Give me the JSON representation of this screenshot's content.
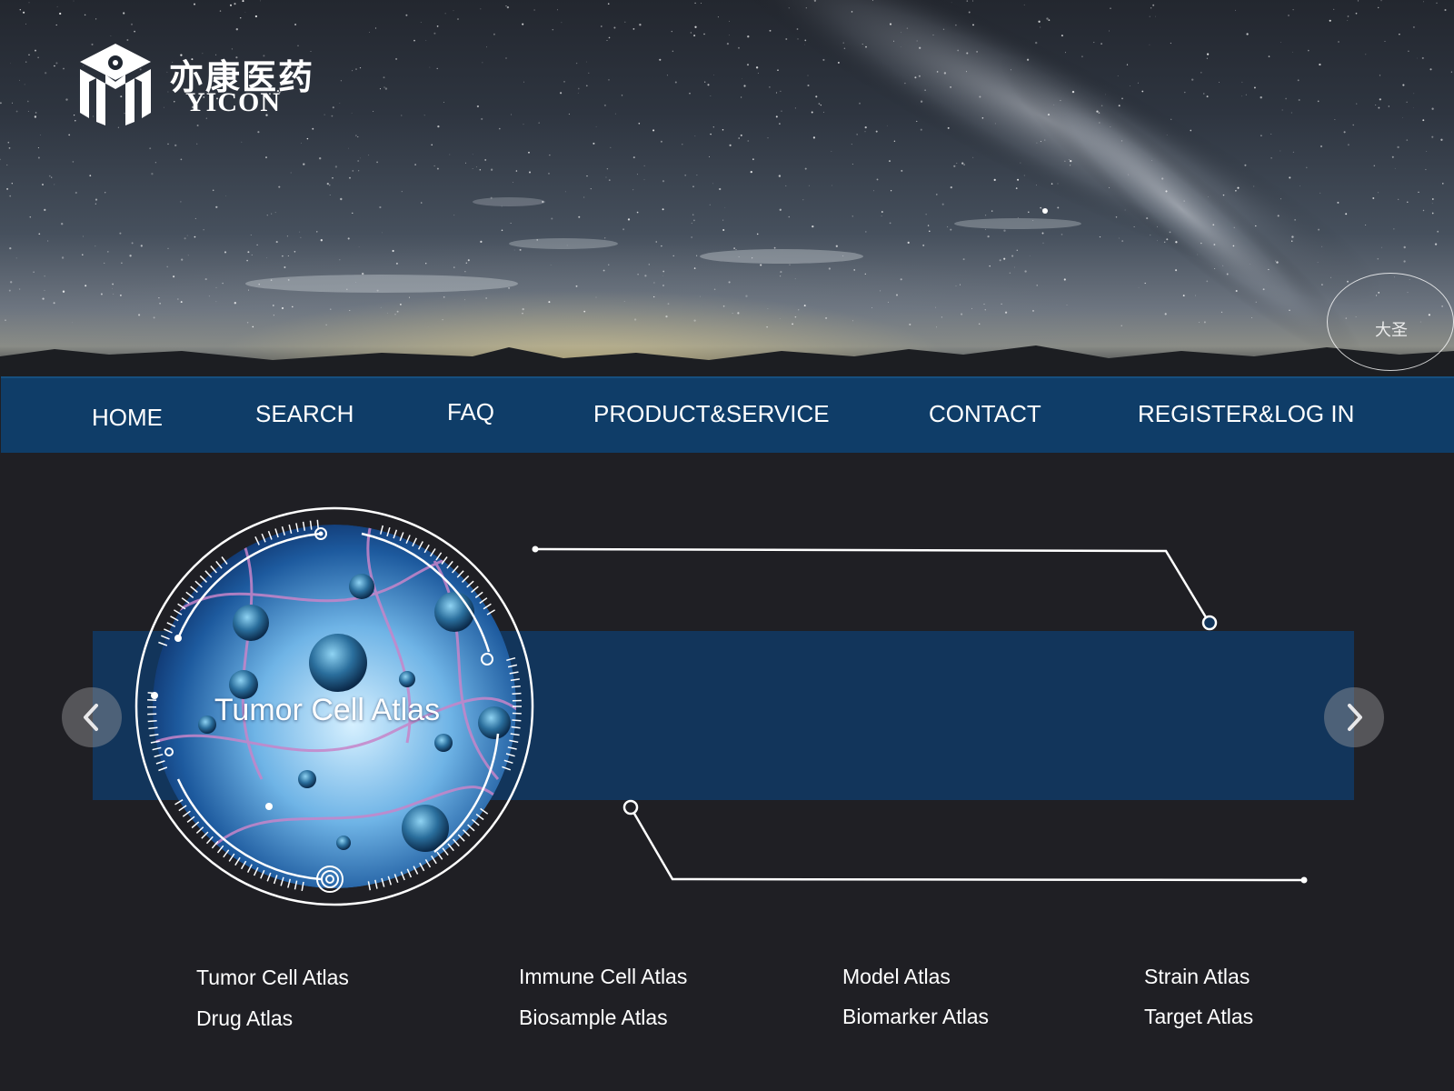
{
  "brand": {
    "name_cn": "亦康医药",
    "name_en": "YICON",
    "logo_icon": "yicon-logo-mark"
  },
  "hero": {
    "watermark_text": "大圣"
  },
  "nav": {
    "items": [
      {
        "label": "HOME"
      },
      {
        "label": "SEARCH"
      },
      {
        "label": "FAQ"
      },
      {
        "label": "PRODUCT&SERVICE"
      },
      {
        "label": "CONTACT"
      },
      {
        "label": "REGISTER&LOG IN"
      }
    ]
  },
  "carousel": {
    "current_slide_title": "Tumor Cell Atlas",
    "prev_icon": "chevron-left-icon",
    "next_icon": "chevron-right-icon"
  },
  "atlas_links": [
    {
      "label": "Tumor Cell Atlas"
    },
    {
      "label": "Immune Cell Atlas"
    },
    {
      "label": "Model Atlas"
    },
    {
      "label": "Strain Atlas"
    },
    {
      "label": "Drug Atlas"
    },
    {
      "label": "Biosample Atlas"
    },
    {
      "label": "Biomarker Atlas"
    },
    {
      "label": "Target Atlas"
    }
  ],
  "colors": {
    "nav_bg": "#0f3d68",
    "band_bg": "#12355b",
    "page_bg": "#1f1f24",
    "text": "#ffffff"
  }
}
